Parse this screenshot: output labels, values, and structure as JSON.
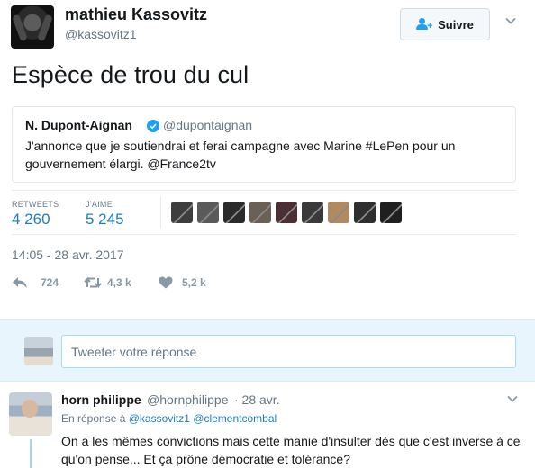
{
  "tweet": {
    "author_name": "mathieu Kassovitz",
    "author_handle": "@kassovitz1",
    "follow_label": "Suivre",
    "text": "Espèce de trou du cul",
    "quote": {
      "name": "N. Dupont-Aignan",
      "handle": "@dupontaignan",
      "text": "J'annonce que je soutiendrai et ferai campagne avec Marine #LePen pour un gouvernement élargi. @France2tv"
    },
    "stats": {
      "retweets_label": "RETWEETS",
      "retweets_value": "4 260",
      "likes_label": "J'AIME",
      "likes_value": "5 245"
    },
    "likers": [
      {
        "icon": "liker-avatar",
        "color": "#3d3d3d"
      },
      {
        "icon": "liker-avatar",
        "color": "#5a5a5a"
      },
      {
        "icon": "liker-avatar",
        "color": "#2b2b2b"
      },
      {
        "icon": "liker-avatar",
        "color": "#6b6055"
      },
      {
        "icon": "liker-avatar",
        "color": "#4a2f35"
      },
      {
        "icon": "liker-avatar",
        "color": "#3a3a3a"
      },
      {
        "icon": "liker-avatar",
        "color": "#b08a60"
      },
      {
        "icon": "liker-avatar",
        "color": "#2f2f2f"
      },
      {
        "icon": "liker-avatar",
        "color": "#1f1f1f"
      }
    ],
    "timestamp": "14:05 - 28 avr. 2017",
    "actions": {
      "reply_count": "724",
      "retweet_count": "4,3 k",
      "like_count": "5,2 k"
    }
  },
  "reply_box": {
    "placeholder": "Tweeter votre réponse"
  },
  "reply": {
    "name": "horn philippe",
    "handle": "@hornphilippe",
    "time": "· 28 avr.",
    "reply_to_prefix": "En réponse à",
    "reply_to_1": "@kassovitz1",
    "reply_to_2": "@clementcombal",
    "text": "On a les mêmes convictions mais cette manie d'insulter dès que c'est inverse à ce qu'on pense... Et ça prône démocratie et tolérance?"
  },
  "colors": {
    "accent": "#1da1f2",
    "link": "#1b7fc4",
    "muted": "#657786",
    "reply_band": "#e8f5fd"
  }
}
